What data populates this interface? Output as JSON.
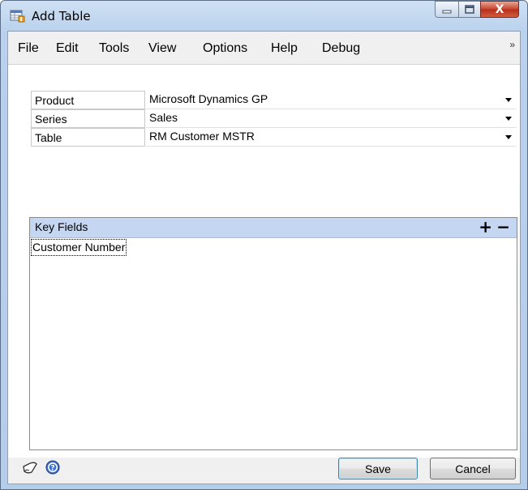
{
  "window": {
    "title": "Add Table"
  },
  "caption": {
    "minimize": "—",
    "maximize": "☐",
    "close": "X"
  },
  "menu": {
    "items": [
      "File",
      "Edit",
      "Tools",
      "View",
      "Options",
      "Help",
      "Debug"
    ],
    "overflow": "»"
  },
  "fields": [
    {
      "label": "Product",
      "value": "Microsoft Dynamics GP"
    },
    {
      "label": "Series",
      "value": "Sales"
    },
    {
      "label": "Table",
      "value": "RM Customer MSTR"
    }
  ],
  "key_fields": {
    "title": "Key Fields",
    "add_label": "+",
    "remove_label": "−",
    "items": [
      "Customer Number"
    ]
  },
  "footer": {
    "save_label": "Save",
    "cancel_label": "Cancel"
  },
  "colors": {
    "header_blue": "#c5d6f3",
    "close_red": "#c7432d"
  }
}
